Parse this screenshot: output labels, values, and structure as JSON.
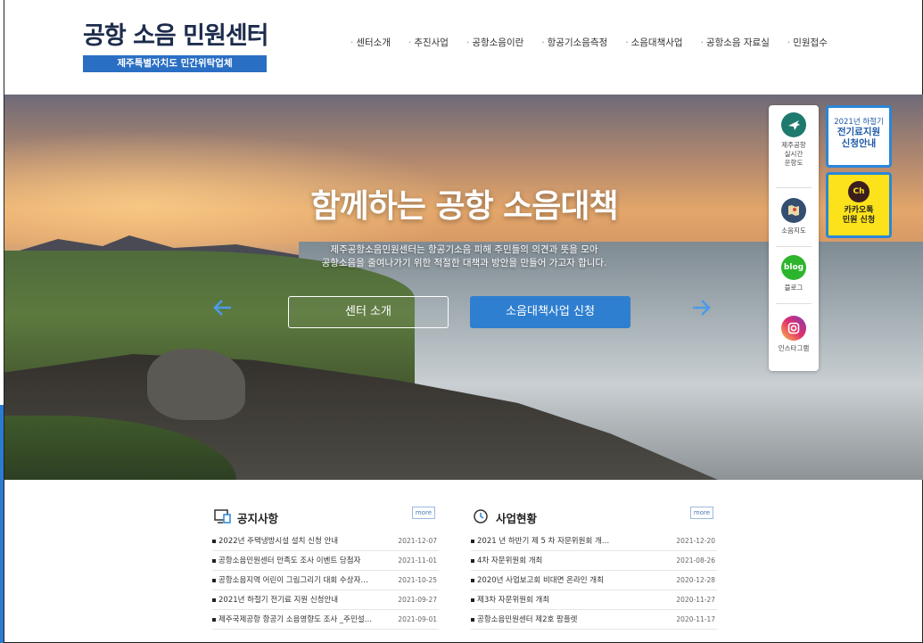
{
  "header": {
    "logo_title": "공항 소음 민원센터",
    "logo_subtitle": "제주특별자치도 민간위탁업체",
    "nav": [
      "센터소개",
      "추진사업",
      "공항소음이란",
      "항공기소음측정",
      "소음대책사업",
      "공항소음 자료실",
      "민원접수"
    ]
  },
  "hero": {
    "title": "함께하는 공항 소음대책",
    "desc_line1": "제주공항소음민원센터는 항공기소음 피해 주민들의 의견과 뜻을 모아",
    "desc_line2": "공항소음을 줄여나가기 위한 적절한 대책과 방안을 만들어 가고자 합니다.",
    "btn_intro": "센터 소개",
    "btn_apply": "소음대책사업 신청"
  },
  "quick_menu": {
    "item1_l1": "제주공항",
    "item1_l2": "실시간",
    "item1_l3": "운항도",
    "item2": "소음지도",
    "item3_icon_text": "blog",
    "item3": "블로그",
    "item4": "인스타그램"
  },
  "banners": {
    "elec_l1": "2021년 하절기",
    "elec_l2": "전기료지원",
    "elec_l3": "신청안내",
    "kakao_icon_text": "Ch",
    "kakao_l1": "카카오톡",
    "kakao_l2": "민원 신청"
  },
  "notice": {
    "title": "공지사항",
    "more": "more",
    "items": [
      {
        "title": "2022년 주택냉방시설 설치 신청 안내",
        "date": "2021-12-07"
      },
      {
        "title": "공항소음민원센터 만족도 조사 이벤트 당첨자",
        "date": "2021-11-01"
      },
      {
        "title": "공항소음지역 어린이 그림그리기 대회 수상자…",
        "date": "2021-10-25"
      },
      {
        "title": "2021년 하절기 전기료 지원 신청안내",
        "date": "2021-09-27"
      },
      {
        "title": "제주국제공항 항공기 소음영향도 조사 _주민설…",
        "date": "2021-09-01"
      }
    ]
  },
  "business": {
    "title": "사업현황",
    "more": "more",
    "items": [
      {
        "title": "2021 년 하반기 제 5 차 자문위원회 개…",
        "date": "2021-12-20"
      },
      {
        "title": "4차 자문위원회 개최",
        "date": "2021-08-26"
      },
      {
        "title": "2020년 사업보고회 비대면 온라인 개최",
        "date": "2020-12-28"
      },
      {
        "title": "제3차 자문위원회 개최",
        "date": "2020-11-27"
      },
      {
        "title": "공항소음민원센터 제2호 팜플렛",
        "date": "2020-11-17"
      }
    ]
  },
  "colors": {
    "brand_blue": "#2a6fc4",
    "button_blue": "#2f7fd0",
    "kakao_yellow": "#fbe21a"
  }
}
